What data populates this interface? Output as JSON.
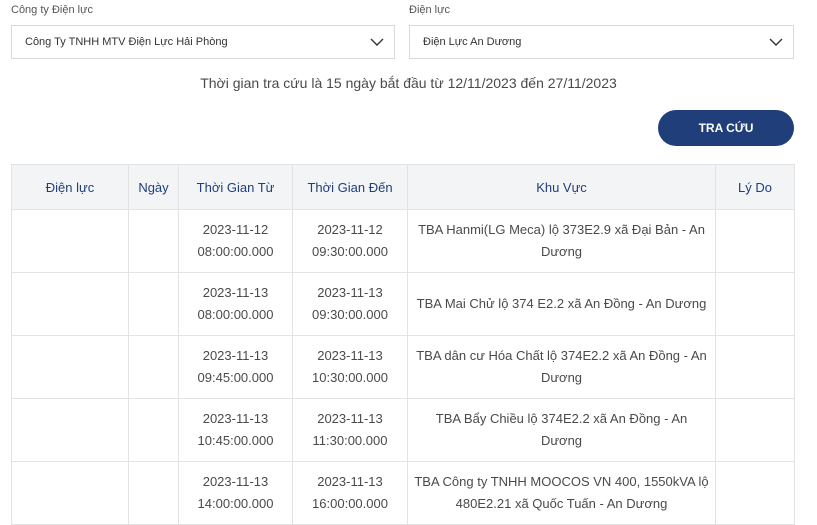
{
  "filters": {
    "company_label": "Công ty Điện lực",
    "company_value": "Công Ty TNHH MTV Điện Lực Hải Phòng",
    "branch_label": "Điện lực",
    "branch_value": "Điện Lực An Dương"
  },
  "notice": "Thời gian tra cứu là 15 ngày bắt đầu từ 12/11/2023 đến 27/11/2023",
  "search_button": "TRA CỨU",
  "table": {
    "headers": [
      "Điện lực",
      "Ngày",
      "Thời Gian Từ",
      "Thời Gian Đến",
      "Khu Vực",
      "Lý Do"
    ],
    "rows": [
      {
        "dien_luc": "",
        "ngay": "",
        "from_date": "2023-11-12",
        "from_time": "08:00:00.000",
        "to_date": "2023-11-12",
        "to_time": "09:30:00.000",
        "area_1": "TBA Hanmi(LG Meca) lộ 373E2.9 xã Đại Bản - An",
        "area_2": "Dương",
        "reason": ""
      },
      {
        "dien_luc": "",
        "ngay": "",
        "from_date": "2023-11-13",
        "from_time": "08:00:00.000",
        "to_date": "2023-11-13",
        "to_time": "09:30:00.000",
        "area_1": "TBA Mai Chử lộ 374 E2.2 xã An Đồng - An Dương",
        "area_2": "",
        "reason": ""
      },
      {
        "dien_luc": "",
        "ngay": "",
        "from_date": "2023-11-13",
        "from_time": "09:45:00.000",
        "to_date": "2023-11-13",
        "to_time": "10:30:00.000",
        "area_1": "TBA dân cư Hóa Chất lộ 374E2.2 xã An Đồng - An",
        "area_2": "Dương",
        "reason": ""
      },
      {
        "dien_luc": "",
        "ngay": "",
        "from_date": "2023-11-13",
        "from_time": "10:45:00.000",
        "to_date": "2023-11-13",
        "to_time": "11:30:00.000",
        "area_1": "TBA Bẩy Chiều lộ 374E2.2 xã An Đồng - An Dương",
        "area_2": "",
        "reason": ""
      },
      {
        "dien_luc": "",
        "ngay": "",
        "from_date": "2023-11-13",
        "from_time": "14:00:00.000",
        "to_date": "2023-11-13",
        "to_time": "16:00:00.000",
        "area_1": "TBA Công ty TNHH MOOCOS VN 400, 1550kVA lộ",
        "area_2": "480E2.21 xã Quốc Tuấn - An Dương",
        "reason": ""
      }
    ]
  }
}
